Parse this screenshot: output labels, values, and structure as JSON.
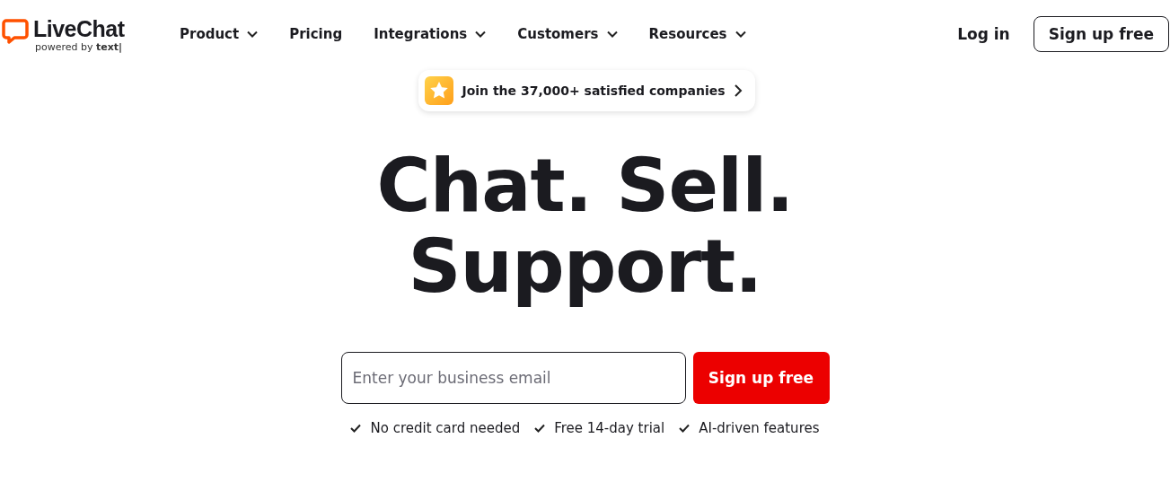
{
  "logo": {
    "name": "LiveChat",
    "powered_by": "powered by",
    "brand": "text|"
  },
  "nav": [
    {
      "label": "Product",
      "kind": "menu"
    },
    {
      "label": "Pricing",
      "kind": "link"
    },
    {
      "label": "Integrations",
      "kind": "menu"
    },
    {
      "label": "Customers",
      "kind": "menu"
    },
    {
      "label": "Resources",
      "kind": "menu"
    }
  ],
  "login": "Log in",
  "signup_button": "Sign up free",
  "badge": {
    "text": "Join the 37,000+ satisfied companies"
  },
  "headline": [
    "Chat. Sell.",
    "Support."
  ],
  "email_field": {
    "placeholder": "Enter your business email"
  },
  "submit_button": "Sign up free",
  "features": [
    "No credit card needed",
    "Free 14-day trial",
    "AI-driven features"
  ]
}
